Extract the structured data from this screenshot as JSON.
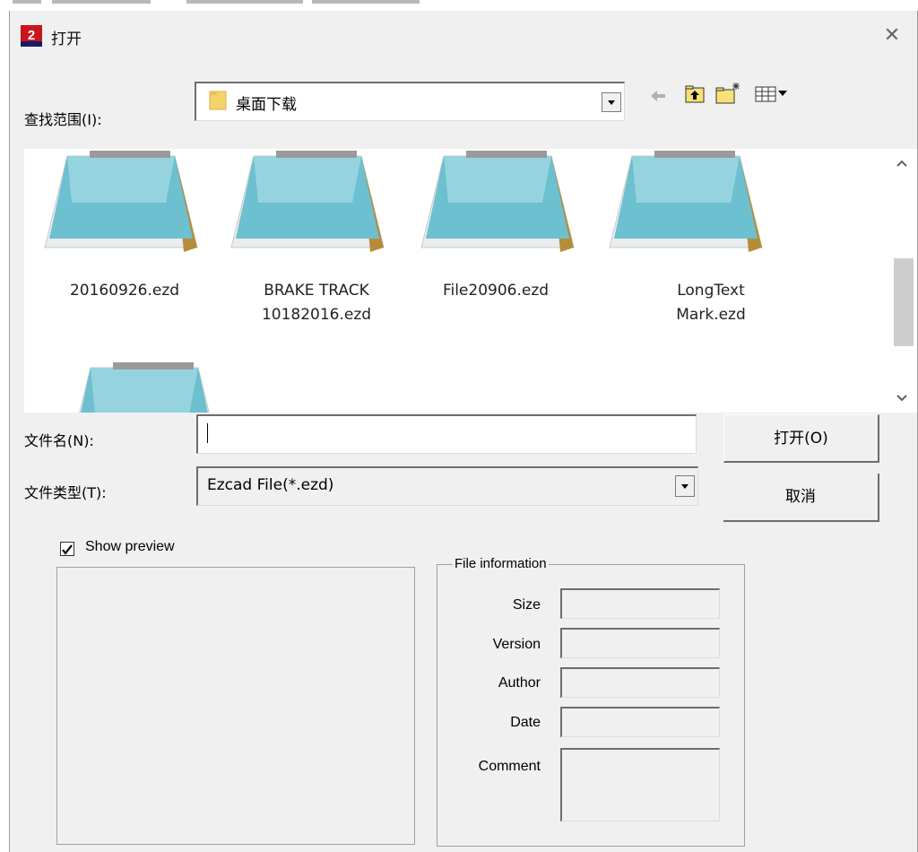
{
  "window": {
    "title": "打开",
    "close_glyph": "✕"
  },
  "lookin": {
    "label": "查找范围(I):",
    "value": "桌面下载"
  },
  "files": [
    {
      "line1": "20160926.ezd",
      "line2": ""
    },
    {
      "line1": "BRAKE TRACK",
      "line2": "10182016.ezd"
    },
    {
      "line1": "File20906.ezd",
      "line2": ""
    },
    {
      "line1": "LongText",
      "line2": "Mark.ezd"
    }
  ],
  "filename": {
    "label": "文件名(N):",
    "value": ""
  },
  "filetype": {
    "label": "文件类型(T):",
    "value": "Ezcad File(*.ezd)"
  },
  "buttons": {
    "open": "打开(O)",
    "cancel": "取消"
  },
  "preview": {
    "checkbox_label": "Show preview",
    "checked": true
  },
  "file_info": {
    "legend": "File information",
    "size_label": "Size",
    "version_label": "Version",
    "author_label": "Author",
    "date_label": "Date",
    "comment_label": "Comment"
  },
  "icons": {
    "app": "ezcad-app-icon",
    "folder": "folder-icon",
    "back": "back-arrow-icon",
    "up": "up-folder-icon",
    "new_folder": "new-folder-icon",
    "view_menu": "view-menu-icon",
    "file": "notepad-file-icon"
  },
  "colors": {
    "window_bg": "#f0f0f0",
    "list_bg": "#ffffff",
    "notepad_blue": "#5fb6c8",
    "folder_yellow": "#f5d36a"
  }
}
